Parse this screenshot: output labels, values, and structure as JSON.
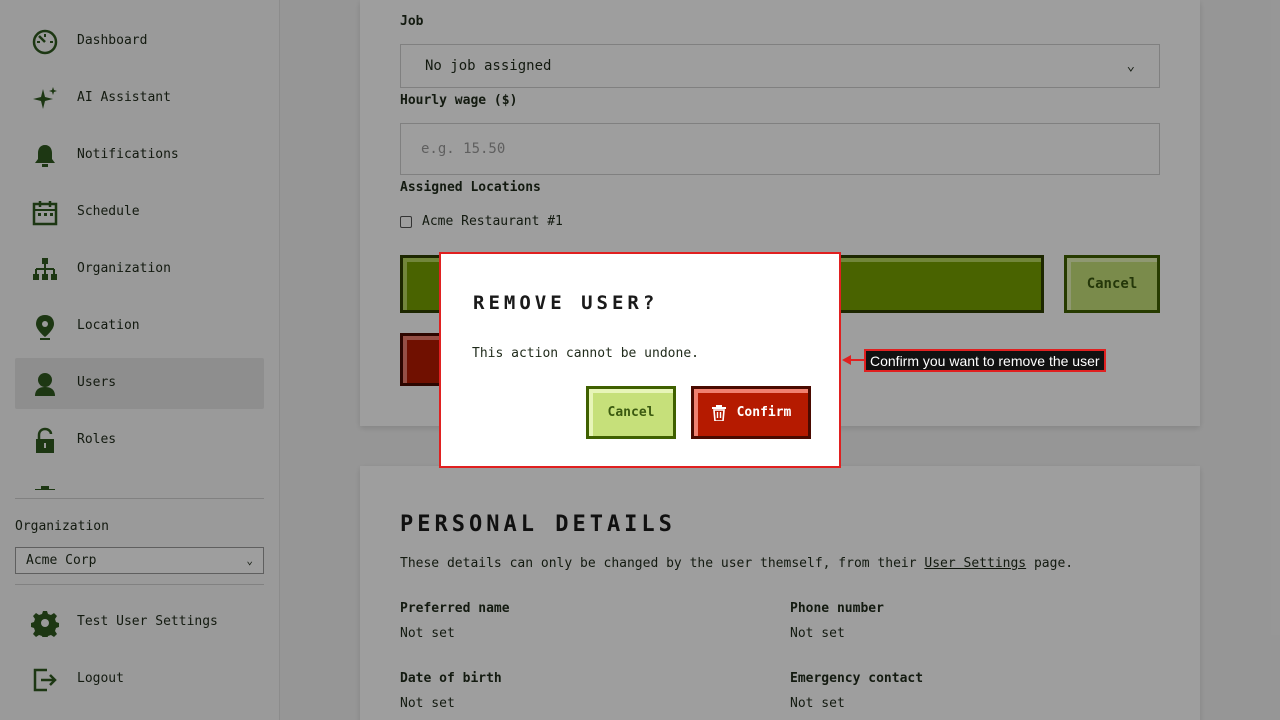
{
  "sidebar": {
    "items": [
      {
        "label": "Dashboard",
        "icon": "dashboard-icon",
        "active": false
      },
      {
        "label": "AI Assistant",
        "icon": "sparkle-icon",
        "active": false
      },
      {
        "label": "Notifications",
        "icon": "bell-icon",
        "active": false
      },
      {
        "label": "Schedule",
        "icon": "calendar-icon",
        "active": false
      },
      {
        "label": "Organization",
        "icon": "org-chart-icon",
        "active": false
      },
      {
        "label": "Location",
        "icon": "location-pin-icon",
        "active": false
      },
      {
        "label": "Users",
        "icon": "user-icon",
        "active": true
      },
      {
        "label": "Roles",
        "icon": "lock-icon",
        "active": false
      }
    ],
    "org_label": "Organization",
    "org_selected": "Acme Corp",
    "bottom_items": [
      {
        "label": "Test User Settings",
        "icon": "gear-icon"
      },
      {
        "label": "Logout",
        "icon": "logout-icon"
      }
    ]
  },
  "form": {
    "job_label": "Job",
    "job_value": "No job assigned",
    "wage_label": "Hourly wage ($)",
    "wage_placeholder": "e.g. 15.50",
    "locations_label": "Assigned Locations",
    "location_option": "Acme Restaurant #1",
    "cancel_label": "Cancel"
  },
  "personal": {
    "title": "PERSONAL DETAILS",
    "desc_before": "These details can only be changed by the user themself, from their ",
    "desc_link": "User Settings",
    "desc_after": " page.",
    "fields": [
      {
        "label": "Preferred name",
        "value": "Not set"
      },
      {
        "label": "Phone number",
        "value": "Not set"
      },
      {
        "label": "Date of birth",
        "value": "Not set"
      },
      {
        "label": "Emergency contact",
        "value": "Not set"
      }
    ]
  },
  "modal": {
    "title": "REMOVE USER?",
    "text": "This action cannot be undone.",
    "cancel_label": "Cancel",
    "confirm_label": "Confirm"
  },
  "annotation": {
    "text": "Confirm you want to remove the user"
  },
  "colors": {
    "accent_green": "#76a000",
    "danger_red": "#b51a00",
    "annotation_red": "#e02020",
    "icon_green": "#2f5a20"
  }
}
